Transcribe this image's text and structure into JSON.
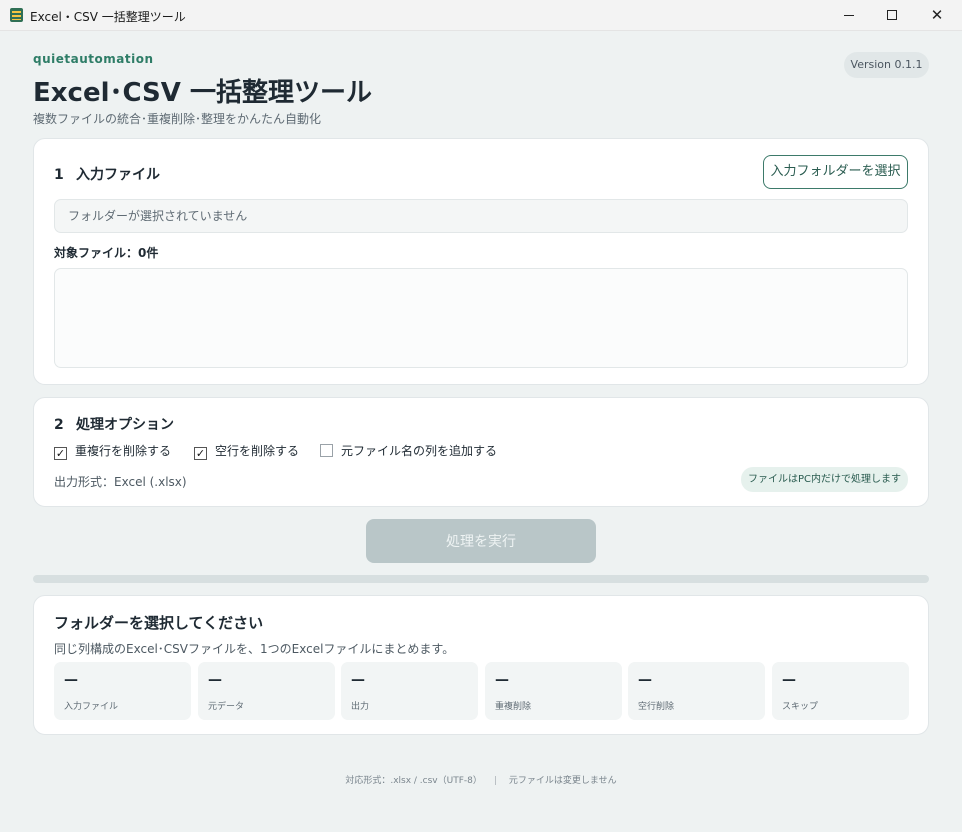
{
  "window": {
    "title": "Excel・CSV 一括整理ツール",
    "min_glyph": "",
    "close_glyph": "✕"
  },
  "header": {
    "brand": "quietautomation",
    "version": "Version 0.1.1",
    "title": "Excel･CSV 一括整理ツール",
    "subtitle": "複数ファイルの統合･重複削除･整理をかんたん自動化"
  },
  "input_section": {
    "number": "1",
    "title": "入力ファイル",
    "select_button": "入力フォルダーを選択",
    "folder_placeholder": "フォルダーが選択されていません",
    "file_count_label": "対象ファイル：0件",
    "files": []
  },
  "options_section": {
    "number": "2",
    "title": "処理オプション",
    "options": [
      {
        "label": "重複行を削除する",
        "checked": true
      },
      {
        "label": "空行を削除する",
        "checked": true
      },
      {
        "label": "元ファイル名の列を追加する",
        "checked": false
      }
    ],
    "output_format": "出力形式：Excel (.xlsx)",
    "local_badge": "ファイルはPC内だけで処理します"
  },
  "run_button": "処理を実行",
  "progress": 0,
  "status": {
    "title": "フォルダーを選択してください",
    "description": "同じ列構成のExcel･CSVファイルを、1つのExcelファイルにまとめます。",
    "stats": [
      {
        "value": "—",
        "label": "入力ファイル"
      },
      {
        "value": "—",
        "label": "元データ"
      },
      {
        "value": "—",
        "label": "出力"
      },
      {
        "value": "—",
        "label": "重複削除"
      },
      {
        "value": "—",
        "label": "空行削除"
      },
      {
        "value": "—",
        "label": "スキップ"
      }
    ]
  },
  "footer": {
    "formats": "対応形式：.xlsx / .csv（UTF-8）",
    "separator": "|",
    "note": "元ファイルは変更しません"
  },
  "colors": {
    "accent": "#2e7d67",
    "background": "#eef2f2",
    "disabled_button": "#b9c6c8"
  }
}
